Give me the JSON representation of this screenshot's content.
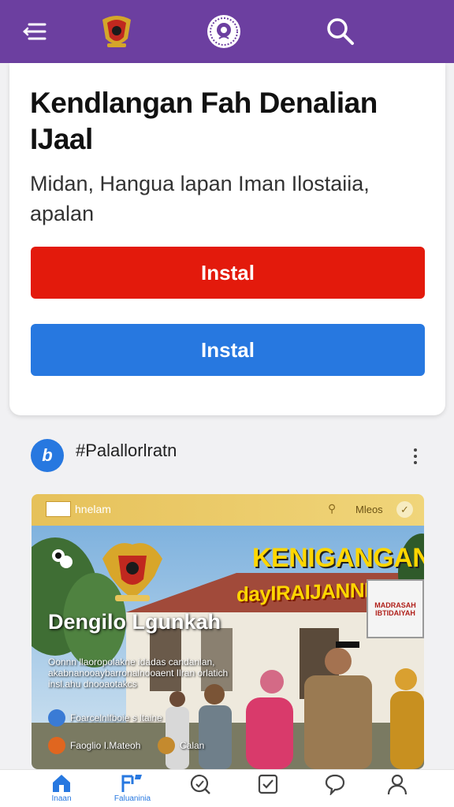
{
  "topbar": {
    "background": "#6c3fa0",
    "icons": [
      "menu-icon",
      "emblem-icon",
      "logo-icon",
      "search-icon"
    ]
  },
  "card": {
    "title": "Kendlangan Fah Denalian IJaal",
    "subtitle": "Midan, Hangua lapan Iman Ilostaiia, apalan",
    "button_red": "Instal",
    "button_blue": "Instal",
    "colors": {
      "red": "#e31a0c",
      "blue": "#2778e0"
    }
  },
  "post": {
    "avatar_letter": "b",
    "handle": "#Palallorlratn"
  },
  "banner": {
    "bar_name": "hnelam",
    "bar_right": "Mleos",
    "headline_1": "KENIGANGAN",
    "headline_2": "dayIRAIJANNISHAIN",
    "title": "Dengilo Lgunkah",
    "description": "Oonnn llaoropolakne idadas candanlan, akabnanooaybarronalnooaent Ilran orlatich insl.ahu dnooaotakcs",
    "row1": "Foarcelnlfboie s ltaine",
    "row2": "Faoglio I.Mateoh",
    "row2_extra": "Calan",
    "sign_text": "MADRASAH IBTIDAIYAH"
  },
  "bottom_nav": [
    {
      "icon": "home-icon",
      "label": "Inaan"
    },
    {
      "icon": "flag-icon",
      "label": "Faluaninia"
    },
    {
      "icon": "search-chat-icon",
      "label": ""
    },
    {
      "icon": "checkbox-icon",
      "label": ""
    },
    {
      "icon": "chat-bubble-icon",
      "label": ""
    },
    {
      "icon": "profile-icon",
      "label": ""
    }
  ]
}
